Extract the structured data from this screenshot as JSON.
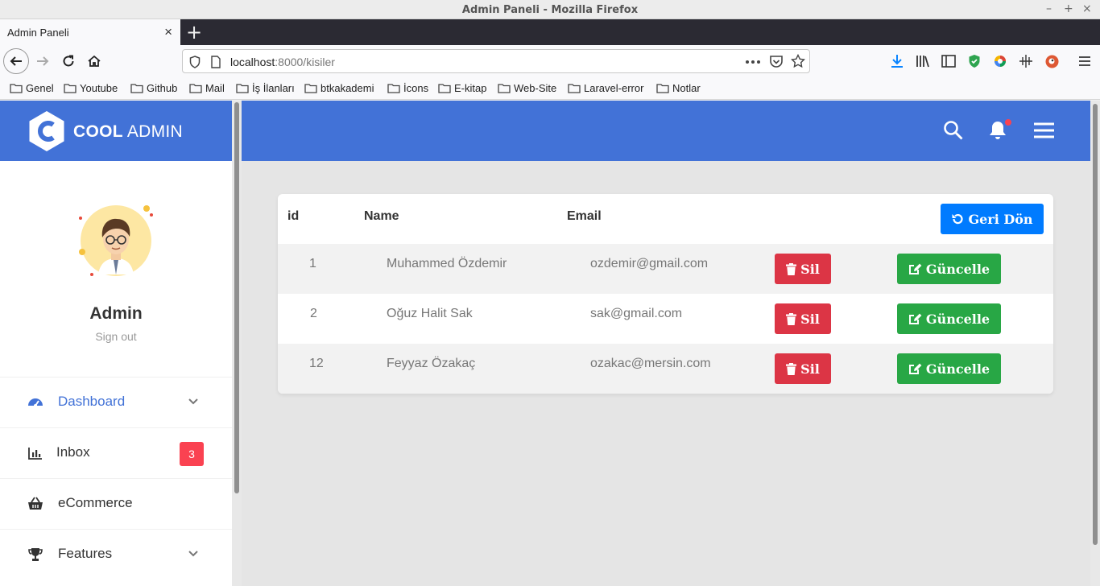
{
  "window": {
    "title": "Admin Paneli - Mozilla Firefox",
    "controls": {
      "minimize": "–",
      "maximize": "+",
      "close": "×"
    }
  },
  "tab": {
    "title": "Admin Paneli",
    "close": "×",
    "new_tab": "+"
  },
  "urlbar": {
    "host": "localhost",
    "rest": ":8000/kisiler"
  },
  "bookmarks": [
    "Genel",
    "Youtube",
    "Github",
    "Mail",
    "İş İlanları",
    "btkakademi",
    "İcons",
    "E-kitap",
    "Web-Site",
    "Laravel-error",
    "Notlar"
  ],
  "sidebar": {
    "logo_bold": "COOL",
    "logo_light": " ADMIN",
    "user_name": "Admin",
    "sign_out": "Sign out",
    "menu": [
      {
        "label": "Dashboard",
        "icon": "tachometer-icon",
        "active": true,
        "has_chevron": true
      },
      {
        "label": "Inbox",
        "icon": "bar-chart-icon",
        "badge": "3"
      },
      {
        "label": "eCommerce",
        "icon": "basket-icon"
      },
      {
        "label": "Features",
        "icon": "trophy-icon",
        "has_chevron": true
      }
    ]
  },
  "table": {
    "headers": {
      "id": "id",
      "name": "Name",
      "email": "Email"
    },
    "back_button": "Geri Dön",
    "delete_label": "Sil",
    "update_label": "Güncelle",
    "rows": [
      {
        "id": "1",
        "name": "Muhammed Özdemir",
        "email": "ozdemir@gmail.com"
      },
      {
        "id": "2",
        "name": "Oğuz Halit Sak",
        "email": "sak@gmail.com"
      },
      {
        "id": "12",
        "name": "Feyyaz Özakaç",
        "email": "ozakac@mersin.com"
      }
    ]
  },
  "colors": {
    "brand": "#4272d7",
    "danger": "#dc3545",
    "success": "#28a745",
    "primary": "#007bff",
    "badge": "#fa4251"
  }
}
